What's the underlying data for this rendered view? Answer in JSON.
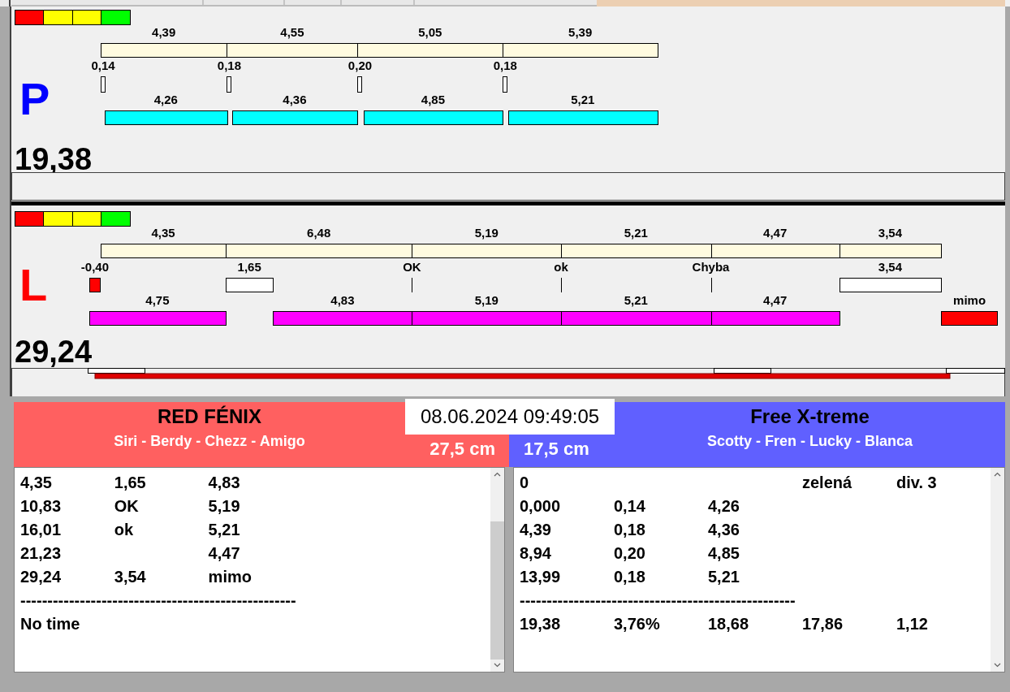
{
  "lanes": [
    {
      "kind": "right",
      "letter": "P",
      "total": "19,38",
      "segments": [
        {
          "value": "4,39",
          "gap": {
            "kind": "marker",
            "label": "0,14"
          },
          "lower": {
            "kind": "bar",
            "value": "4,26"
          }
        },
        {
          "value": "4,55",
          "gap": {
            "kind": "marker",
            "label": "0,18"
          },
          "lower": {
            "kind": "bar",
            "value": "4,36"
          }
        },
        {
          "value": "5,05",
          "gap": {
            "kind": "marker",
            "label": "0,20"
          },
          "lower": {
            "kind": "bar",
            "value": "4,85"
          }
        },
        {
          "value": "5,39",
          "gap": {
            "kind": "marker",
            "label": "0,18"
          },
          "lower": {
            "kind": "bar",
            "value": "5,21"
          }
        }
      ]
    },
    {
      "kind": "left",
      "letter": "L",
      "total": "29,24",
      "segments": [
        {
          "value": "4,35",
          "gap": {
            "kind": "negative",
            "label": "-0,40"
          },
          "lower": {
            "kind": "bar",
            "value": "4,75"
          }
        },
        {
          "value": "6,48",
          "gap": {
            "kind": "box",
            "label": "1,65"
          },
          "lower": {
            "kind": "bar",
            "value": "4,83"
          }
        },
        {
          "value": "5,19",
          "gap": {
            "kind": "tick",
            "label": "OK"
          },
          "lower": {
            "kind": "bar",
            "value": "5,19"
          }
        },
        {
          "value": "5,21",
          "gap": {
            "kind": "tick",
            "label": "ok"
          },
          "lower": {
            "kind": "bar",
            "value": "5,21"
          }
        },
        {
          "value": "4,47",
          "gap": {
            "kind": "tick",
            "label": "Chyba"
          },
          "lower": {
            "kind": "bar",
            "value": "4,47"
          }
        },
        {
          "value": "3,54",
          "gap": {
            "kind": "box",
            "label": "3,54"
          },
          "lower": {
            "kind": "out",
            "value": "mimo"
          }
        }
      ]
    }
  ],
  "datetime": "08.06.2024 09:49:05",
  "teams": [
    {
      "kind": "left",
      "name": "RED FÉNIX",
      "members": "Siri - Berdy - Chezz - Amigo",
      "length": "27,5 cm",
      "lines": [
        {
          "kind": "row",
          "column_1": "4,35",
          "column_2": "1,65",
          "column_3": "4,83"
        },
        {
          "kind": "row",
          "column_1": "10,83",
          "column_2": "OK",
          "column_3": "5,19"
        },
        {
          "kind": "row",
          "column_1": "16,01",
          "column_2": "ok",
          "column_3": "5,21"
        },
        {
          "kind": "row",
          "column_1": "21,23",
          "column_3": "4,47"
        },
        {
          "kind": "row",
          "column_1": "29,24",
          "column_2": "3,54",
          "column_3": "mimo"
        },
        {
          "kind": "rule",
          "text": "---------------------------------------------------"
        },
        {
          "kind": "row",
          "column_1": "No time"
        }
      ]
    },
    {
      "kind": "right",
      "name": "Free X-treme",
      "members": "Scotty - Fren - Lucky - Blanca",
      "length": "17,5 cm",
      "lines": [
        {
          "kind": "row",
          "column_1": "0",
          "column_4": "zelená",
          "column_5": "div. 3"
        },
        {
          "kind": "row",
          "column_1": "0,000",
          "column_2": "0,14",
          "column_3": "4,26"
        },
        {
          "kind": "row",
          "column_1": "4,39",
          "column_2": "0,18",
          "column_3": "4,36"
        },
        {
          "kind": "row",
          "column_1": "8,94",
          "column_2": "0,20",
          "column_3": "4,85"
        },
        {
          "kind": "row",
          "column_1": "13,99",
          "column_2": "0,18",
          "column_3": "5,21"
        },
        {
          "kind": "rule",
          "text": "---------------------------------------------------"
        },
        {
          "kind": "row",
          "column_1": "19,38",
          "column_2": "3,76%",
          "column_3": "18,68",
          "column_4": "17,86",
          "column_5": "1,12"
        }
      ]
    }
  ]
}
